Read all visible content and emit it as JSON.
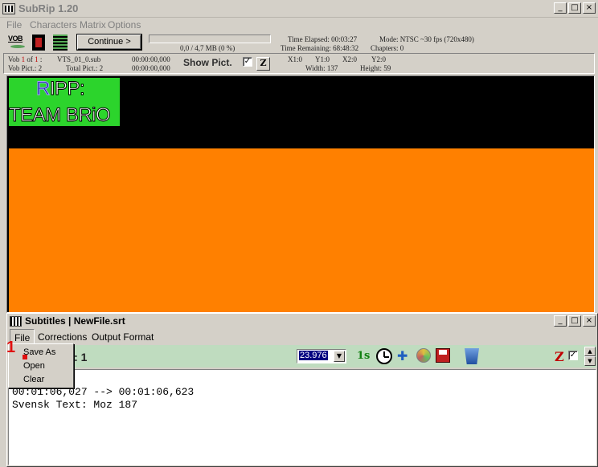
{
  "main_window": {
    "title": "SubRip 1.20",
    "controls": {
      "minimize": "_",
      "maximize": "□",
      "close": "×"
    }
  },
  "main_menu": [
    "File",
    "Characters Matrix",
    "Options"
  ],
  "toolbar": {
    "icons": [
      "vob-icon",
      "film-icon",
      "matrix-icon"
    ],
    "vob_icon_label": "VOB",
    "continue_label": "Continue  >",
    "progress_text": "0,0 / 4,7 MB (0 %)",
    "time_elapsed": "Time Elapsed: 00:03:27",
    "time_remaining": "Time Remaining: 68:48:32",
    "mode": "Mode:  NTSC ~30 fps (720x480)",
    "chapters": "Chapters:  0"
  },
  "vob_info": {
    "vob_prefix": "Vob",
    "vob_num": "1",
    "vob_of": "of",
    "vob_total": "1",
    "vts_file": "VTS_01_0.sub",
    "vob_pict": "Vob Pict.:  2",
    "total_pict": "Total Pict.:  2",
    "time_1": "00:00:00,000",
    "time_2": "00:00:00,000",
    "show_pict_label": "Show Pict.",
    "show_pict_checked": "✓",
    "z_label": "Z",
    "x1": "X1:0",
    "y1": "Y1:0",
    "x2": "X2:0",
    "y2": "Y2:0",
    "width": "Width: 137",
    "height": "Height: 59"
  },
  "preview": {
    "line1_r": "R",
    "line1_rest": "IPP:",
    "line2": "TEAM BRiO",
    "colors": {
      "background_top": "#000000",
      "background_bottom": "#ff8000",
      "label_bg": "#2cd42c"
    }
  },
  "subtitle_window": {
    "title": "Subtitles | NewFile.srt",
    "controls": {
      "minimize": "_",
      "maximize": "□",
      "close": "×"
    },
    "menu": [
      "File",
      "Corrections",
      "Output Format"
    ],
    "index_text": "dex: 1",
    "fps": "23.976",
    "fps_arrow": "▼",
    "tool_icons": [
      "one-second-icon",
      "clock-icon",
      "puzzle-icon",
      "cd-icon",
      "save-icon",
      "trash-icon"
    ],
    "one_s_label": "1s",
    "puzzle_glyph": "✚",
    "z_label": "Z",
    "z_checked": "✓",
    "spin_up": "▲",
    "spin_down": "▼",
    "editor_line1": "00:01:06,027 --> 00:01:06,623",
    "editor_line2": "Svensk Text: Moz 187"
  },
  "file_dropdown": {
    "items": [
      "Save As",
      "Open",
      "Clear"
    ],
    "marker": "1"
  }
}
